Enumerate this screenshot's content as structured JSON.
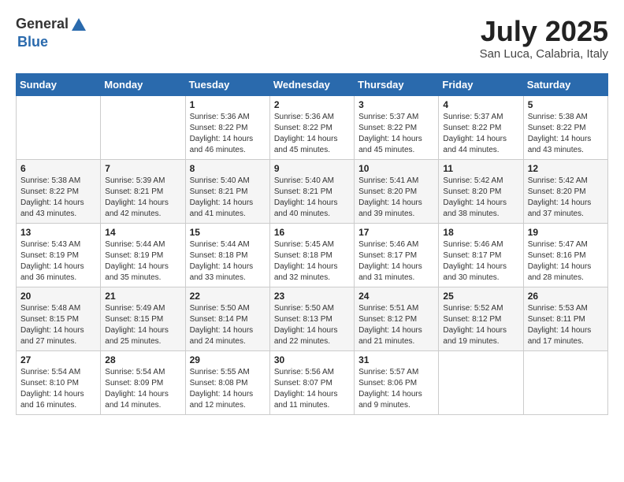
{
  "header": {
    "logo_general": "General",
    "logo_blue": "Blue",
    "month_year": "July 2025",
    "location": "San Luca, Calabria, Italy"
  },
  "weekdays": [
    "Sunday",
    "Monday",
    "Tuesday",
    "Wednesday",
    "Thursday",
    "Friday",
    "Saturday"
  ],
  "weeks": [
    [
      {
        "day": "",
        "sunrise": "",
        "sunset": "",
        "daylight": ""
      },
      {
        "day": "",
        "sunrise": "",
        "sunset": "",
        "daylight": ""
      },
      {
        "day": "1",
        "sunrise": "Sunrise: 5:36 AM",
        "sunset": "Sunset: 8:22 PM",
        "daylight": "Daylight: 14 hours and 46 minutes."
      },
      {
        "day": "2",
        "sunrise": "Sunrise: 5:36 AM",
        "sunset": "Sunset: 8:22 PM",
        "daylight": "Daylight: 14 hours and 45 minutes."
      },
      {
        "day": "3",
        "sunrise": "Sunrise: 5:37 AM",
        "sunset": "Sunset: 8:22 PM",
        "daylight": "Daylight: 14 hours and 45 minutes."
      },
      {
        "day": "4",
        "sunrise": "Sunrise: 5:37 AM",
        "sunset": "Sunset: 8:22 PM",
        "daylight": "Daylight: 14 hours and 44 minutes."
      },
      {
        "day": "5",
        "sunrise": "Sunrise: 5:38 AM",
        "sunset": "Sunset: 8:22 PM",
        "daylight": "Daylight: 14 hours and 43 minutes."
      }
    ],
    [
      {
        "day": "6",
        "sunrise": "Sunrise: 5:38 AM",
        "sunset": "Sunset: 8:22 PM",
        "daylight": "Daylight: 14 hours and 43 minutes."
      },
      {
        "day": "7",
        "sunrise": "Sunrise: 5:39 AM",
        "sunset": "Sunset: 8:21 PM",
        "daylight": "Daylight: 14 hours and 42 minutes."
      },
      {
        "day": "8",
        "sunrise": "Sunrise: 5:40 AM",
        "sunset": "Sunset: 8:21 PM",
        "daylight": "Daylight: 14 hours and 41 minutes."
      },
      {
        "day": "9",
        "sunrise": "Sunrise: 5:40 AM",
        "sunset": "Sunset: 8:21 PM",
        "daylight": "Daylight: 14 hours and 40 minutes."
      },
      {
        "day": "10",
        "sunrise": "Sunrise: 5:41 AM",
        "sunset": "Sunset: 8:20 PM",
        "daylight": "Daylight: 14 hours and 39 minutes."
      },
      {
        "day": "11",
        "sunrise": "Sunrise: 5:42 AM",
        "sunset": "Sunset: 8:20 PM",
        "daylight": "Daylight: 14 hours and 38 minutes."
      },
      {
        "day": "12",
        "sunrise": "Sunrise: 5:42 AM",
        "sunset": "Sunset: 8:20 PM",
        "daylight": "Daylight: 14 hours and 37 minutes."
      }
    ],
    [
      {
        "day": "13",
        "sunrise": "Sunrise: 5:43 AM",
        "sunset": "Sunset: 8:19 PM",
        "daylight": "Daylight: 14 hours and 36 minutes."
      },
      {
        "day": "14",
        "sunrise": "Sunrise: 5:44 AM",
        "sunset": "Sunset: 8:19 PM",
        "daylight": "Daylight: 14 hours and 35 minutes."
      },
      {
        "day": "15",
        "sunrise": "Sunrise: 5:44 AM",
        "sunset": "Sunset: 8:18 PM",
        "daylight": "Daylight: 14 hours and 33 minutes."
      },
      {
        "day": "16",
        "sunrise": "Sunrise: 5:45 AM",
        "sunset": "Sunset: 8:18 PM",
        "daylight": "Daylight: 14 hours and 32 minutes."
      },
      {
        "day": "17",
        "sunrise": "Sunrise: 5:46 AM",
        "sunset": "Sunset: 8:17 PM",
        "daylight": "Daylight: 14 hours and 31 minutes."
      },
      {
        "day": "18",
        "sunrise": "Sunrise: 5:46 AM",
        "sunset": "Sunset: 8:17 PM",
        "daylight": "Daylight: 14 hours and 30 minutes."
      },
      {
        "day": "19",
        "sunrise": "Sunrise: 5:47 AM",
        "sunset": "Sunset: 8:16 PM",
        "daylight": "Daylight: 14 hours and 28 minutes."
      }
    ],
    [
      {
        "day": "20",
        "sunrise": "Sunrise: 5:48 AM",
        "sunset": "Sunset: 8:15 PM",
        "daylight": "Daylight: 14 hours and 27 minutes."
      },
      {
        "day": "21",
        "sunrise": "Sunrise: 5:49 AM",
        "sunset": "Sunset: 8:15 PM",
        "daylight": "Daylight: 14 hours and 25 minutes."
      },
      {
        "day": "22",
        "sunrise": "Sunrise: 5:50 AM",
        "sunset": "Sunset: 8:14 PM",
        "daylight": "Daylight: 14 hours and 24 minutes."
      },
      {
        "day": "23",
        "sunrise": "Sunrise: 5:50 AM",
        "sunset": "Sunset: 8:13 PM",
        "daylight": "Daylight: 14 hours and 22 minutes."
      },
      {
        "day": "24",
        "sunrise": "Sunrise: 5:51 AM",
        "sunset": "Sunset: 8:12 PM",
        "daylight": "Daylight: 14 hours and 21 minutes."
      },
      {
        "day": "25",
        "sunrise": "Sunrise: 5:52 AM",
        "sunset": "Sunset: 8:12 PM",
        "daylight": "Daylight: 14 hours and 19 minutes."
      },
      {
        "day": "26",
        "sunrise": "Sunrise: 5:53 AM",
        "sunset": "Sunset: 8:11 PM",
        "daylight": "Daylight: 14 hours and 17 minutes."
      }
    ],
    [
      {
        "day": "27",
        "sunrise": "Sunrise: 5:54 AM",
        "sunset": "Sunset: 8:10 PM",
        "daylight": "Daylight: 14 hours and 16 minutes."
      },
      {
        "day": "28",
        "sunrise": "Sunrise: 5:54 AM",
        "sunset": "Sunset: 8:09 PM",
        "daylight": "Daylight: 14 hours and 14 minutes."
      },
      {
        "day": "29",
        "sunrise": "Sunrise: 5:55 AM",
        "sunset": "Sunset: 8:08 PM",
        "daylight": "Daylight: 14 hours and 12 minutes."
      },
      {
        "day": "30",
        "sunrise": "Sunrise: 5:56 AM",
        "sunset": "Sunset: 8:07 PM",
        "daylight": "Daylight: 14 hours and 11 minutes."
      },
      {
        "day": "31",
        "sunrise": "Sunrise: 5:57 AM",
        "sunset": "Sunset: 8:06 PM",
        "daylight": "Daylight: 14 hours and 9 minutes."
      },
      {
        "day": "",
        "sunrise": "",
        "sunset": "",
        "daylight": ""
      },
      {
        "day": "",
        "sunrise": "",
        "sunset": "",
        "daylight": ""
      }
    ]
  ]
}
